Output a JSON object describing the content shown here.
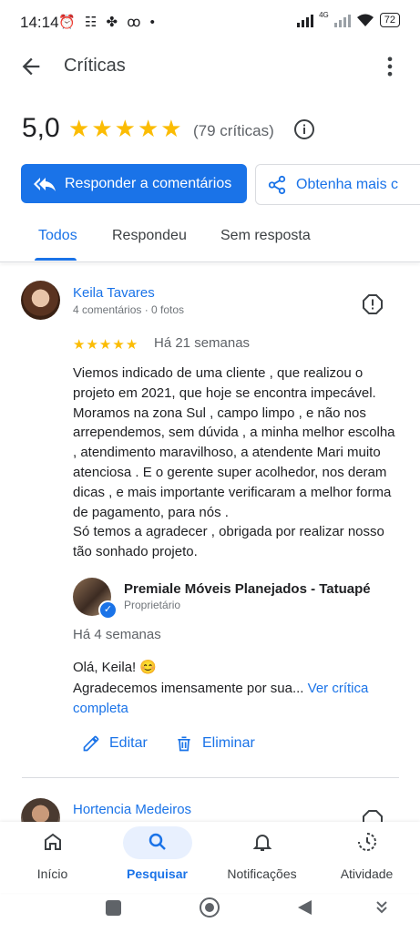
{
  "status_bar": {
    "time": "14:14",
    "icons": "⏰ ☷ ✤ ꝏ •",
    "network": "4G",
    "battery": "72"
  },
  "app_bar": {
    "title": "Críticas"
  },
  "rating": {
    "score": "5,0",
    "stars": 5,
    "count": "(79 críticas)"
  },
  "actions": {
    "reply_label": "Responder a comentários",
    "more_label": "Obtenha mais c"
  },
  "tabs": [
    {
      "label": "Todos",
      "active": true
    },
    {
      "label": "Respondeu"
    },
    {
      "label": "Sem resposta"
    }
  ],
  "reviews": [
    {
      "name": "Keila Tavares",
      "meta": "4 comentários · 0 fotos",
      "stars": 5,
      "date": "Há 21 semanas",
      "text": "Viemos indicado de uma cliente , que realizou o projeto em 2021, que hoje se encontra impecável. Moramos na zona Sul , campo limpo , e não nos arrependemos, sem dúvida , a minha melhor escolha , atendimento maravilhoso, a atendente Mari muito atenciosa . E o gerente super acolhedor, nos deram dicas , e mais importante verificaram a melhor forma de pagamento, para nós .\nSó temos a agradecer , obrigada por realizar nosso tão sonhado projeto.",
      "owner_reply": {
        "owner_name": "Premiale Móveis Planejados - Tatuapé",
        "role": "Proprietário",
        "date": "Há 4 semanas",
        "greeting": "Olá, Keila! 😊",
        "text": "Agradecemos imensamente por sua... ",
        "link": "Ver crítica completa"
      },
      "edit_label": "Editar",
      "delete_label": "Eliminar"
    },
    {
      "name": "Hortencia Medeiros"
    }
  ],
  "bottom_nav": [
    {
      "label": "Início",
      "icon": "home-icon"
    },
    {
      "label": "Pesquisar",
      "icon": "search-icon",
      "active": true
    },
    {
      "label": "Notificações",
      "icon": "bell-icon"
    },
    {
      "label": "Atividade",
      "icon": "activity-icon"
    }
  ],
  "colors": {
    "accent": "#1a73e8",
    "star": "#fbbc04",
    "active_pill": "#e8f0fe"
  }
}
